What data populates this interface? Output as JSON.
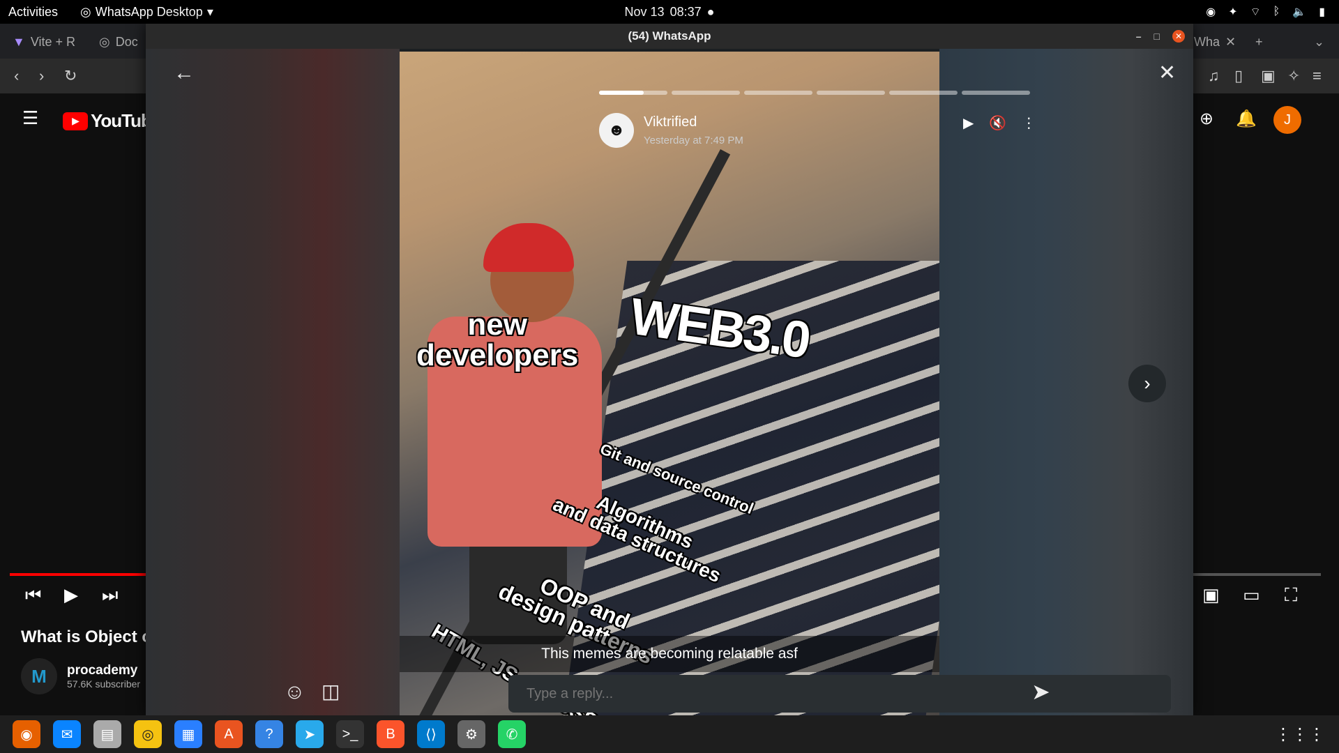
{
  "topbar": {
    "activities": "Activities",
    "app_name": "WhatsApp Desktop",
    "date": "Nov 13",
    "time": "08:37",
    "tray_icons": [
      "discord-icon",
      "accessibility-icon",
      "wifi-icon",
      "bluetooth-icon",
      "volume-icon",
      "battery-icon"
    ]
  },
  "browser": {
    "tabs": [
      {
        "label": "Vite + R",
        "icon": "vite-icon"
      },
      {
        "label": "Doc",
        "icon": "docs-icon"
      },
      {
        "label": "Wha",
        "icon": "whatsapp-icon"
      }
    ],
    "youtube": {
      "logo_text": "YouTube",
      "avatar_letter": "J",
      "video_title": "What is Object o",
      "channel_name": "procademy",
      "channel_subs": "57.6K subscriber"
    }
  },
  "whatsapp": {
    "window_title": "(54) WhatsApp",
    "story": {
      "author_name": "Viktrified",
      "timestamp": "Yesterday at 7:49 PM",
      "segment_count": 6,
      "current_segment_progress": 0.65,
      "caption": "This memes are becoming relatable asf",
      "meme_texts": {
        "kid": "new\ndevelopers",
        "top": "WEB3.0",
        "step1": "Git and source control",
        "step2": "Algorithms\nand data structures",
        "step3": "OOP and\ndesign patterns",
        "step4": "HTML, JS and CSS"
      }
    },
    "reply": {
      "placeholder": "Type a reply..."
    }
  },
  "dock": {
    "apps": [
      "firefox-icon",
      "thunderbird-icon",
      "files-icon",
      "rhythmbox-icon",
      "writer-icon",
      "app-center-icon",
      "help-icon",
      "telegram-icon",
      "terminal-icon",
      "brave-icon",
      "vscode-icon",
      "settings-icon",
      "whatsapp-icon"
    ]
  }
}
